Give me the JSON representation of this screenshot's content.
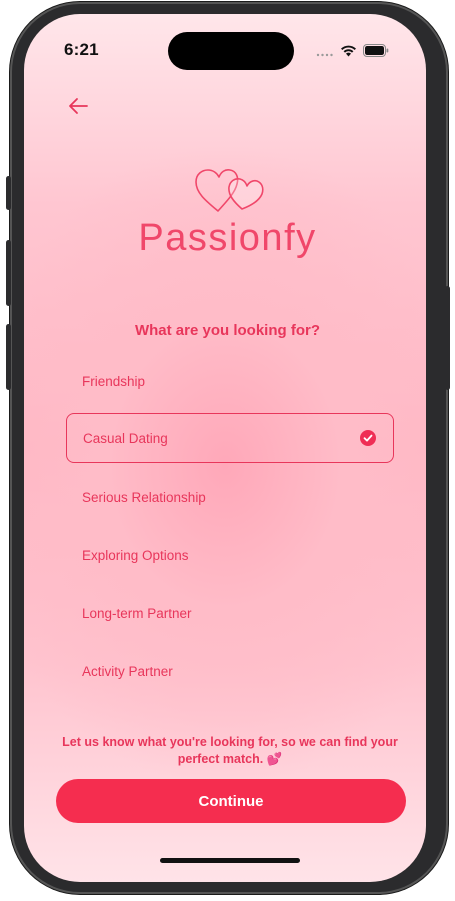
{
  "status_bar": {
    "time": "6:21",
    "signal_icon": "signal-dots-icon",
    "wifi_icon": "wifi-icon",
    "battery_icon": "battery-icon"
  },
  "nav": {
    "back_icon": "arrow-left-icon"
  },
  "brand": {
    "logo_icon": "two-hearts-icon",
    "name": "Passionfy",
    "color": "#f0476a"
  },
  "question": "What are you looking for?",
  "options": [
    {
      "label": "Friendship",
      "selected": false
    },
    {
      "label": "Casual Dating",
      "selected": true
    },
    {
      "label": "Serious Relationship",
      "selected": false
    },
    {
      "label": "Exploring Options",
      "selected": false
    },
    {
      "label": "Long-term Partner",
      "selected": false
    },
    {
      "label": "Activity Partner",
      "selected": false
    }
  ],
  "selected_check_icon": "checkmark-circle-icon",
  "hint": {
    "text": "Let us know what you're looking for, so we can find your perfect match.",
    "emoji": "💕"
  },
  "continue_label": "Continue",
  "colors": {
    "accent": "#f52d4f",
    "text_accent": "#e8365b"
  }
}
